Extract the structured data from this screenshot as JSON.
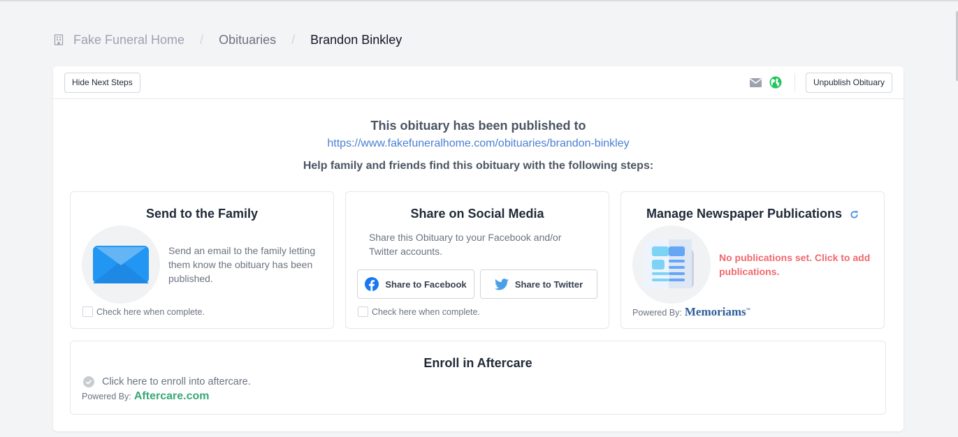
{
  "breadcrumb": {
    "icon": "building-icon",
    "items": [
      "Fake Funeral Home",
      "Obituaries",
      "Brandon Binkley"
    ],
    "separator": "/"
  },
  "header": {
    "hide_steps_label": "Hide Next Steps",
    "email_icon": "envelope-icon",
    "globe_icon": "globe-icon",
    "unpublish_label": "Unpublish Obituary"
  },
  "publish": {
    "title": "This obituary has been published to",
    "url": "https://www.fakefuneralhome.com/obituaries/brandon-binkley",
    "steps_title": "Help family and friends find this obituary with the following steps:"
  },
  "tiles": {
    "family": {
      "title": "Send to the Family",
      "icon": "envelope-icon",
      "description": "Send an email to the family letting them know the obituary has been published.",
      "check_label": "Check here when complete.",
      "checked": false
    },
    "social": {
      "title": "Share on Social Media",
      "description": "Share this Obituary to your Facebook and/or Twitter accounts.",
      "facebook_label": "Share to Facebook",
      "twitter_label": "Share to Twitter",
      "check_label": "Check here when complete.",
      "checked": false
    },
    "newspaper": {
      "title": "Manage Newspaper Publications",
      "refresh_icon": "refresh-icon",
      "icon": "newspaper-icon",
      "status": "No publications set. Click to add publications.",
      "powered_by_label": "Powered By:",
      "powered_by_brand": "Memoriams"
    },
    "aftercare": {
      "title": "Enroll in Aftercare",
      "enroll_label": "Click here to enroll into aftercare.",
      "powered_by_label": "Powered By:",
      "powered_by_brand": "Aftercare.com"
    }
  },
  "colors": {
    "link": "#4a7fd4",
    "warning": "#f0686d",
    "aftercare_brand": "#3aa776",
    "memoriams_brand": "#2d5e99",
    "globe": "#22c55e"
  }
}
